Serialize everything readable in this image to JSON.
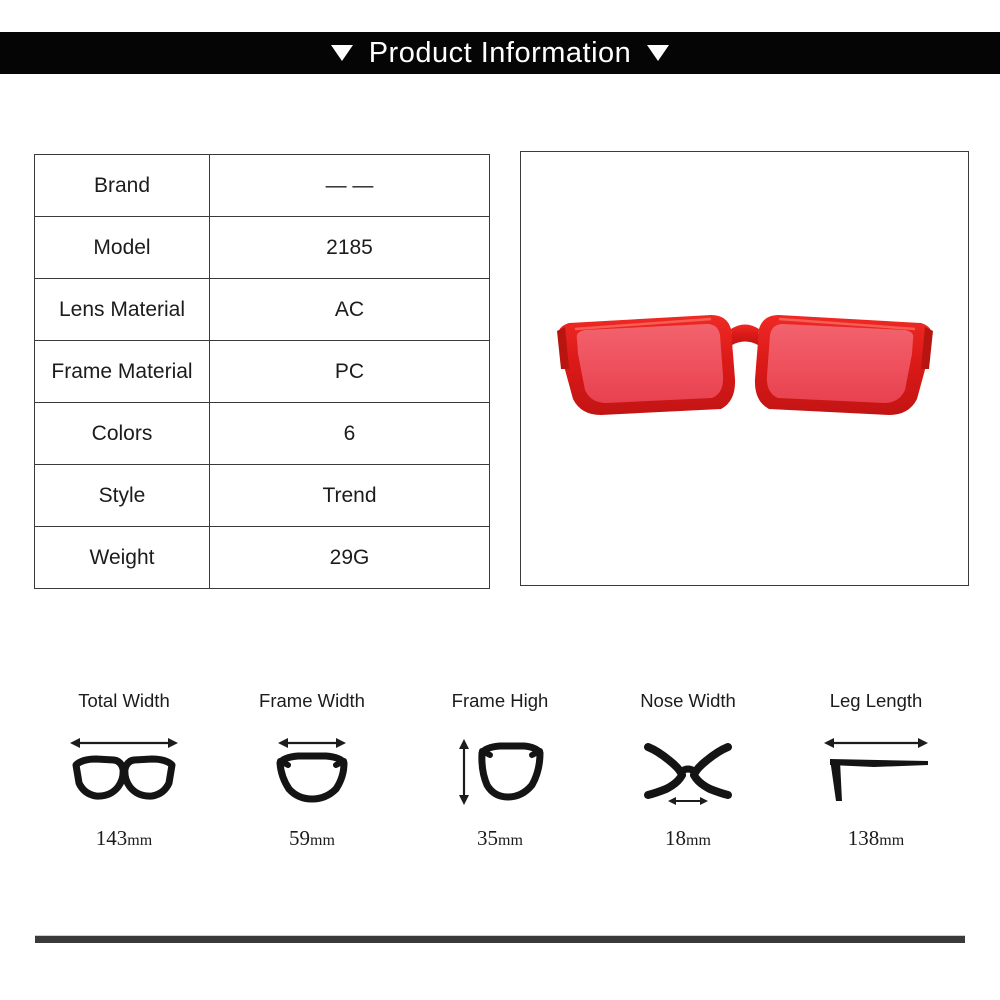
{
  "header": {
    "title": "Product Information",
    "left_marker": "triangle-down",
    "right_marker": "triangle-down",
    "background_color": "#050505",
    "text_color": "#ffffff"
  },
  "spec_table": {
    "rows": [
      {
        "label": "Brand",
        "value": "— —"
      },
      {
        "label": "Model",
        "value": "2185"
      },
      {
        "label": "Lens Material",
        "value": "AC"
      },
      {
        "label": "Frame Material",
        "value": "PC"
      },
      {
        "label": "Colors",
        "value": "6"
      },
      {
        "label": "Style",
        "value": "Trend"
      },
      {
        "label": "Weight",
        "value": "29G"
      }
    ]
  },
  "product_photo": {
    "alt": "red rectangular sunglasses front view",
    "frame_color": "#e02020",
    "lens_color": "#ef5560",
    "background_color": "#ffffff"
  },
  "measurements": [
    {
      "title": "Total Width",
      "value": "143",
      "unit": "mm",
      "icon": "glasses-full-front-icon"
    },
    {
      "title": "Frame Width",
      "value": "59",
      "unit": "mm",
      "icon": "glasses-single-lens-icon"
    },
    {
      "title": "Frame High",
      "value": "35",
      "unit": "mm",
      "icon": "glasses-lens-height-icon"
    },
    {
      "title": "Nose Width",
      "value": "18",
      "unit": "mm",
      "icon": "glasses-nose-bridge-icon"
    },
    {
      "title": "Leg Length",
      "value": "138",
      "unit": "mm",
      "icon": "glasses-temple-arm-icon"
    }
  ]
}
